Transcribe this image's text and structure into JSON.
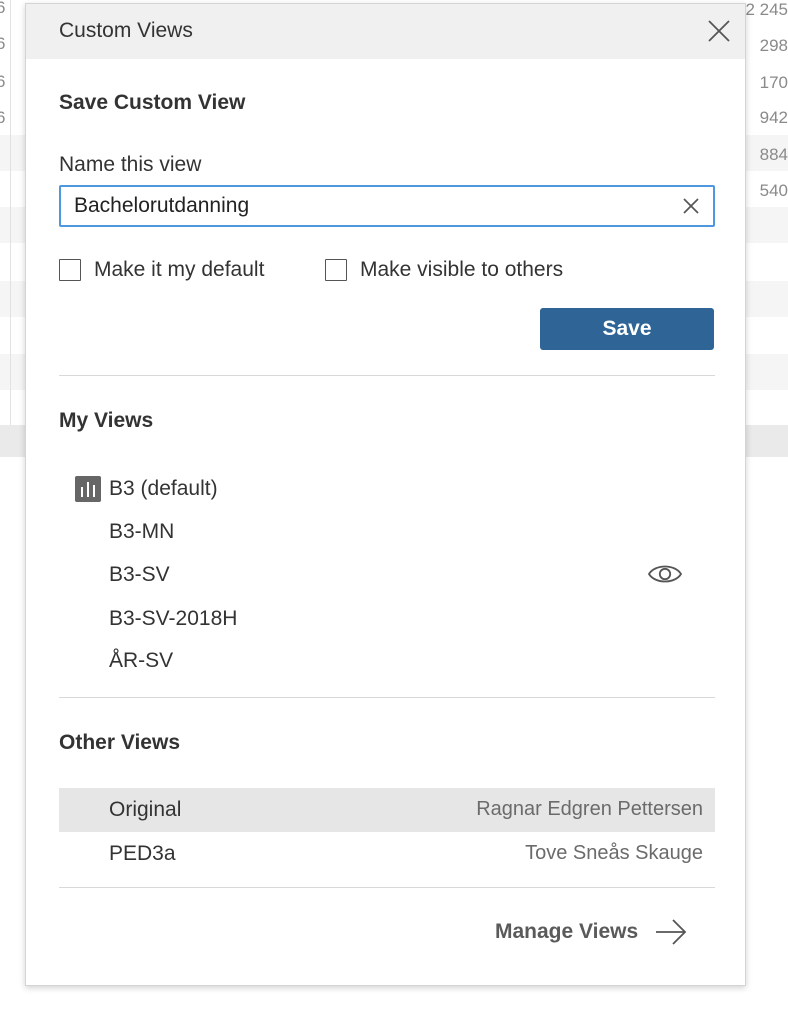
{
  "background": {
    "right_values": [
      "2 245",
      "298",
      "170",
      "942",
      "884",
      "540"
    ],
    "left_marks": [
      "6",
      "6",
      "6",
      "6"
    ]
  },
  "dialog": {
    "title": "Custom Views",
    "save_section": {
      "title": "Save Custom View",
      "name_label": "Name this view",
      "name_value": "Bachelorutdanning",
      "default_checkbox_label": "Make it my default",
      "default_checked": false,
      "visible_checkbox_label": "Make visible to others",
      "visible_checked": false,
      "save_label": "Save",
      "accent_color": "#2e6596"
    },
    "my_views": {
      "title": "My Views",
      "items": [
        {
          "name": "B3 (default)",
          "icon": "bar-chart-icon",
          "shared": false
        },
        {
          "name": "B3-MN",
          "shared": false
        },
        {
          "name": "B3-SV",
          "shared": true,
          "shared_icon": "eye-icon"
        },
        {
          "name": "B3-SV-2018H",
          "shared": false
        },
        {
          "name": "ÅR-SV",
          "shared": false
        }
      ]
    },
    "other_views": {
      "title": "Other Views",
      "items": [
        {
          "name": "Original",
          "owner": "Ragnar Edgren Pettersen",
          "selected": true
        },
        {
          "name": "PED3a",
          "owner": "Tove Sneås Skauge",
          "selected": false
        }
      ]
    },
    "manage_label": "Manage Views",
    "manage_icon": "arrow-right-icon",
    "close_icon": "close-icon"
  }
}
